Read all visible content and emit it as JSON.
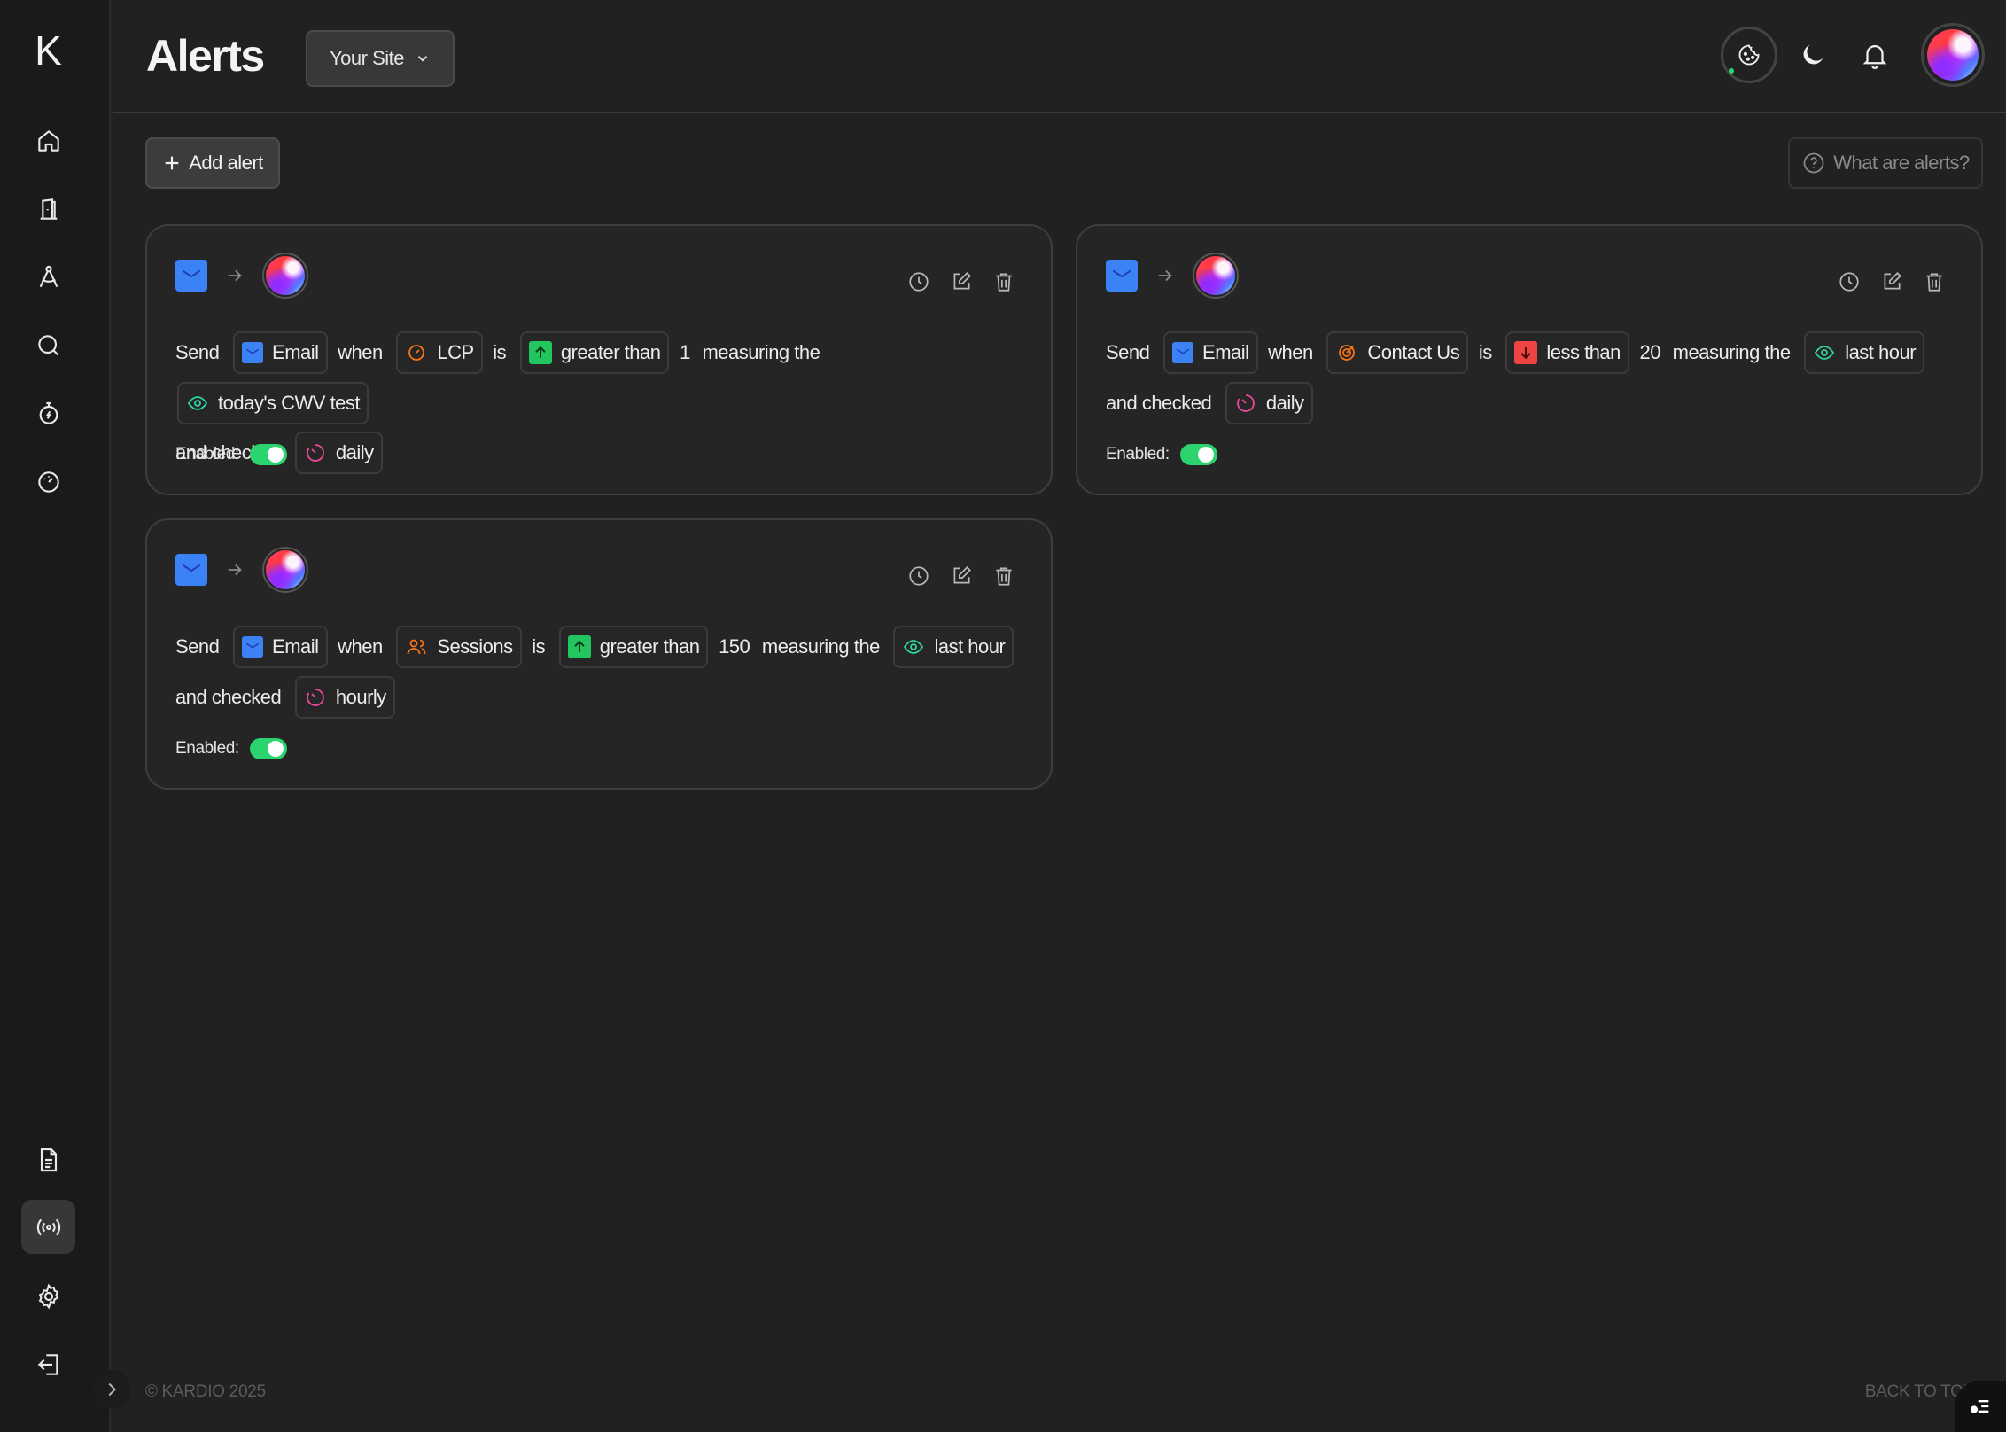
{
  "app": {
    "logo": "K"
  },
  "header": {
    "title": "Alerts",
    "site_select": "Your Site"
  },
  "toolbar": {
    "add_label": "Add alert",
    "help_label": "What are alerts?"
  },
  "alerts": [
    {
      "send": "Send",
      "channel": "Email",
      "when": "when",
      "metric": "LCP",
      "metric_icon": "gauge-icon",
      "is": "is",
      "comparison": "greater than",
      "direction": "up",
      "threshold": "1",
      "measuring": "measuring the",
      "period": "today's CWV test",
      "and_checked": "and checked",
      "frequency": "daily",
      "enabled_label": "Enabled:",
      "enabled": true
    },
    {
      "send": "Send",
      "channel": "Email",
      "when": "when",
      "metric": "Contact Us",
      "metric_icon": "target-icon",
      "is": "is",
      "comparison": "less than",
      "direction": "down",
      "threshold": "20",
      "measuring": "measuring the",
      "period": "last hour",
      "and_checked": "and checked",
      "frequency": "daily",
      "enabled_label": "Enabled:",
      "enabled": true
    },
    {
      "send": "Send",
      "channel": "Email",
      "when": "when",
      "metric": "Sessions",
      "metric_icon": "users-icon",
      "is": "is",
      "comparison": "greater than",
      "direction": "up",
      "threshold": "150",
      "measuring": "measuring the",
      "period": "last hour",
      "and_checked": "and checked",
      "frequency": "hourly",
      "enabled_label": "Enabled:",
      "enabled": true
    }
  ],
  "footer": {
    "copyright": "© KARDIO 2025",
    "back_to_top": "BACK TO TOP"
  },
  "colors": {
    "accent_green": "#2bd46e",
    "mail_blue": "#3b82f6",
    "metric_orange": "#f97316",
    "frequency_pink": "#ec4899",
    "period_teal": "#2dd4a4"
  }
}
